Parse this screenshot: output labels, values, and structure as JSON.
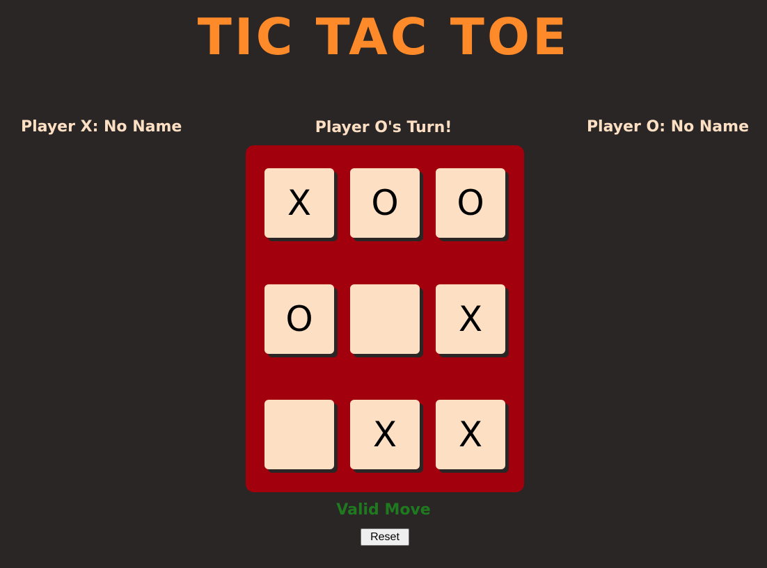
{
  "title": "TIC TAC TOE",
  "players": {
    "x_label": "Player X: No Name",
    "o_label": "Player O: No Name"
  },
  "turn_text": "Player O's Turn!",
  "board": [
    [
      "X",
      "O",
      "O"
    ],
    [
      "O",
      "",
      "X"
    ],
    [
      "",
      "X",
      "X"
    ]
  ],
  "status_text": "Valid Move",
  "reset_label": "Reset",
  "colors": {
    "background": "#2a2626",
    "title": "#ff8a2a",
    "label": "#fde0c4",
    "board": "#a3000d",
    "cell": "#fde0c4",
    "status": "#1f7a1f"
  }
}
